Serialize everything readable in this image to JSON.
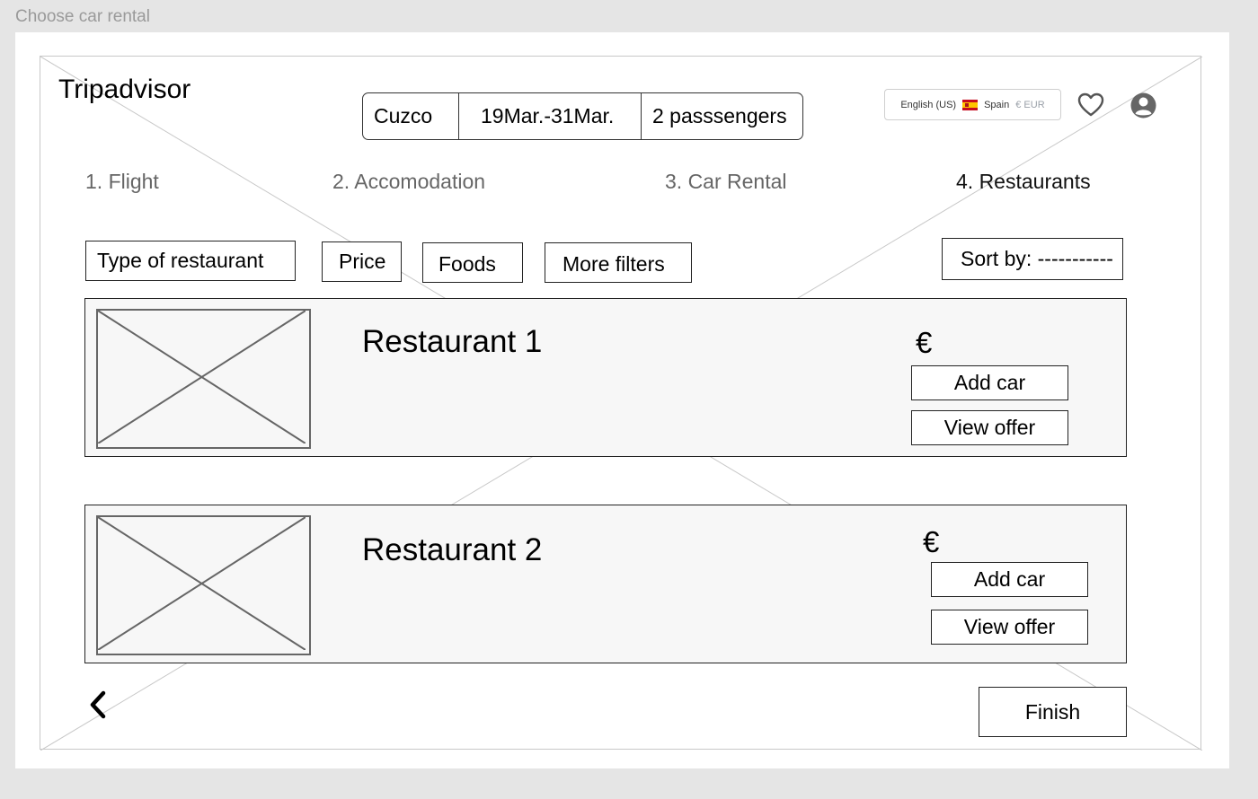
{
  "frame_label": "Choose car rental",
  "brand": "Tripadvisor",
  "trip": {
    "city": "Cuzco",
    "dates": "19Mar.-31Mar.",
    "passengers": "2 passsengers"
  },
  "locale": {
    "language": "English (US)",
    "country": "Spain",
    "currency": "€ EUR",
    "flag": "spain-flag-icon"
  },
  "header_icons": [
    "heart-icon",
    "user-icon"
  ],
  "steps": [
    {
      "label": "1. Flight",
      "active": false
    },
    {
      "label": "2. Accomodation",
      "active": false
    },
    {
      "label": "3. Car Rental",
      "active": false
    },
    {
      "label": "4. Restaurants",
      "active": true
    }
  ],
  "filters": [
    "Type of  restaurant",
    "Price",
    "Foods",
    "More filters"
  ],
  "sort_label": "Sort by: -----------",
  "results": [
    {
      "name": "Restaurant 1",
      "price": "€",
      "add_label": "Add car",
      "view_label": "View offer"
    },
    {
      "name": "Restaurant  2",
      "price": "€",
      "add_label": "Add car",
      "view_label": "View offer"
    }
  ],
  "back_icon": "chevron-left-icon",
  "finish_label": "Finish",
  "colors": {
    "outer_bg": "#e5e5e5",
    "card_bg": "#f7f7f7",
    "step_inactive": "#666666",
    "step_active": "#111111",
    "currency_muted": "#9aa0a8"
  }
}
